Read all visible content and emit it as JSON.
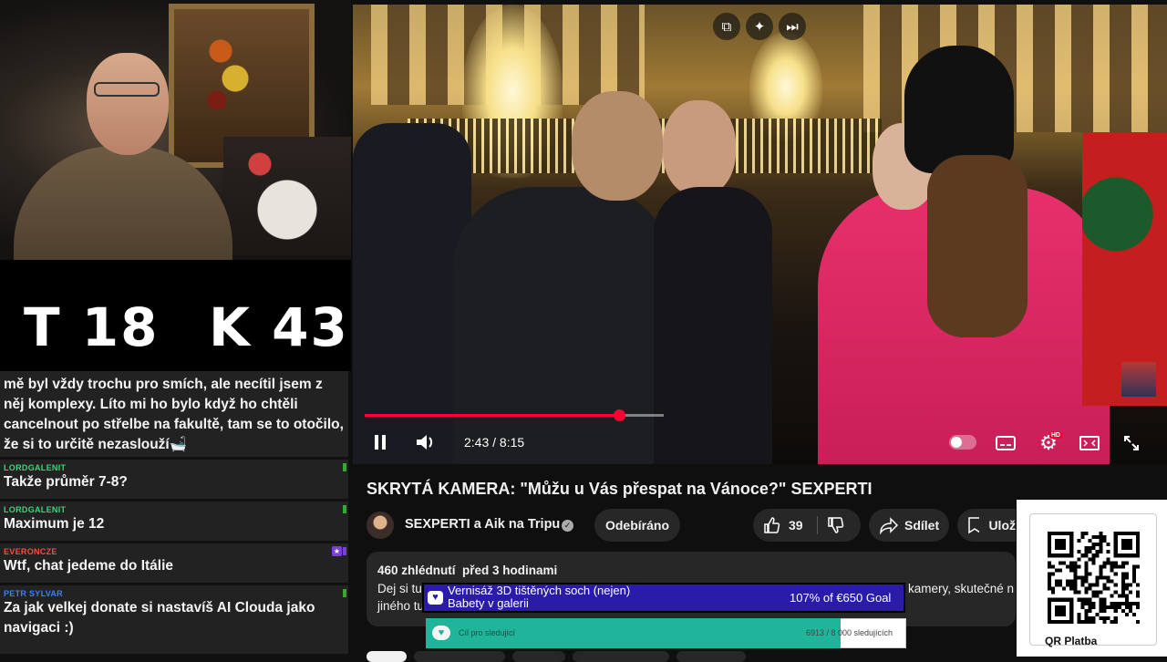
{
  "scoreboard": {
    "left": "T 18",
    "right": "K 43"
  },
  "chat": {
    "messages": [
      {
        "name": "",
        "text": "mě byl vždy trochu pro smích, ale necítil jsem z něj komplexy. Líto mi ho bylo když ho chtěli cancelnout po střelbe na fakultě, tam se to otočilo, že si to určitě nezaslouží🛁",
        "color": "#37d67a"
      },
      {
        "name": "LORDGALENIT",
        "text": "Takže průměr 7-8?",
        "color": "#37d67a"
      },
      {
        "name": "LORDGALENIT",
        "text": "Maximum je 12",
        "color": "#37d67a"
      },
      {
        "name": "EVERONCZE",
        "text": "Wtf, chat jedeme do Itálie",
        "color": "#ff4a3d"
      },
      {
        "name": "PETR SYLVAR",
        "text": "Za jak velkej donate si nastavíš AI Clouda jako navigaci :)",
        "color": "#3d7dff"
      }
    ]
  },
  "player": {
    "time_current": "2:43",
    "time_separator": "/",
    "time_total": "8:15",
    "progress_fraction": 0.867,
    "hd_badge": "HD",
    "accent": "#ff0033"
  },
  "video": {
    "title": "SKRYTÁ KAMERA: \"Můžu u Vás přespat na Vánoce?\" SEXPERTI",
    "channel_name": "SEXPERTI a Aik na Tripu",
    "subscribe_label": "Odebíráno",
    "likes": "39",
    "share_label": "Sdílet",
    "save_label": "Ulož",
    "views": "460 zhlédnutí",
    "age": "před 3 hodinami",
    "desc_line1_left": "Dej si tu",
    "desc_line1_right": "kamery, skutečné n",
    "desc_line2_left": "jiného tu"
  },
  "donation": {
    "title_line1": "Vernisáž 3D tištěných soch (nejen)",
    "title_line2": "Babety v galerii",
    "goal": "107% of €650 Goal",
    "accent": "#2a1ca8"
  },
  "followers": {
    "label": "Cíl pro sledující",
    "count_current": "6913",
    "count_goal": "8 000",
    "count_text": "6913 / 8 000 sledujících",
    "fraction": 0.864,
    "accent": "#1fb59a"
  },
  "qr": {
    "label": "QR Platba"
  }
}
